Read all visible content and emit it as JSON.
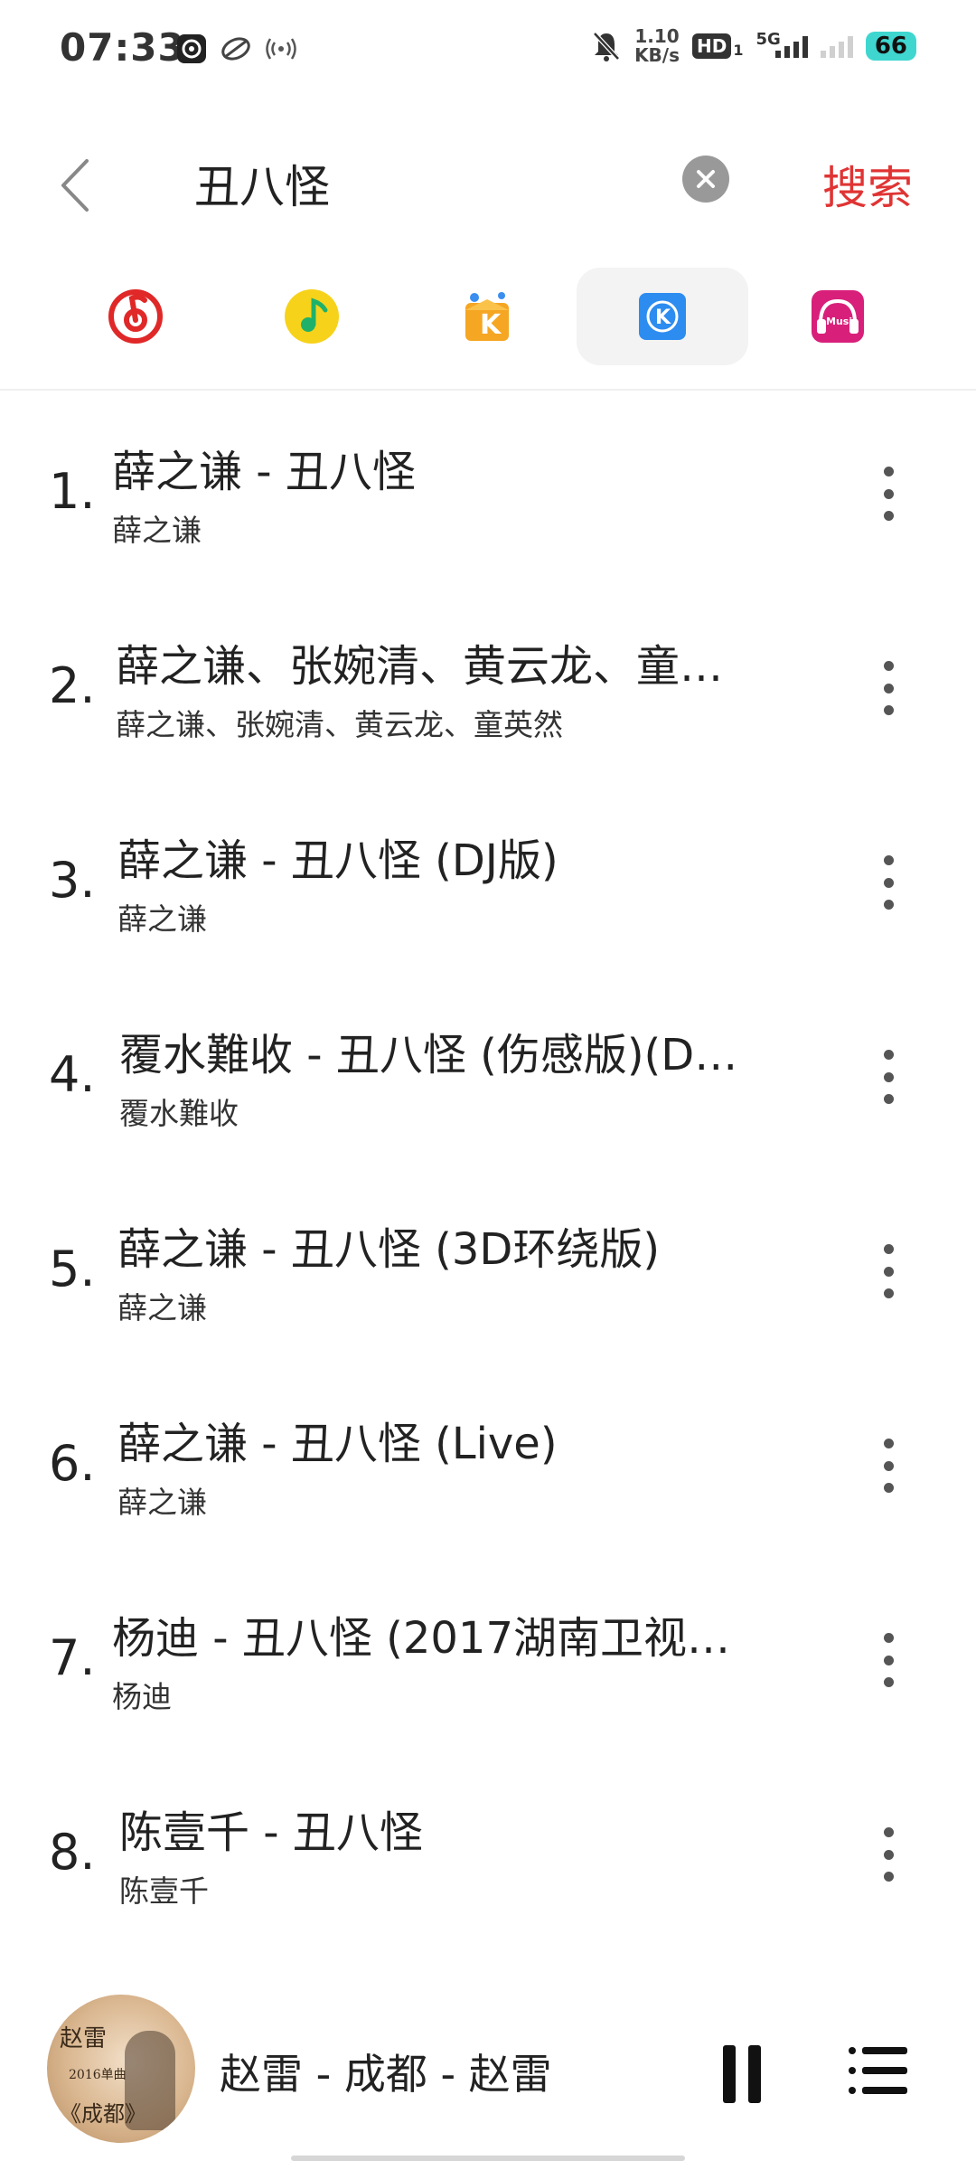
{
  "status_bar": {
    "time": "07:33",
    "netspeed_value": "1.10",
    "netspeed_unit": "KB/s",
    "hd": "HD",
    "hd_sub": "1",
    "network": "5G",
    "battery": "66"
  },
  "search": {
    "query": "丑八怪",
    "search_button": "搜索"
  },
  "source_tabs": [
    {
      "name": "netease-cloud-music",
      "active": false
    },
    {
      "name": "qq-music",
      "active": false
    },
    {
      "name": "kuwo-music",
      "active": false
    },
    {
      "name": "kugou-music",
      "active": true
    },
    {
      "name": "migu-music",
      "active": false
    }
  ],
  "songs": [
    {
      "index": "1.",
      "title": "薛之谦 - 丑八怪",
      "artist": "薛之谦"
    },
    {
      "index": "2.",
      "title": "薛之谦、张婉清、黄云龙、童…",
      "artist": "薛之谦、张婉清、黄云龙、童英然"
    },
    {
      "index": "3.",
      "title": "薛之谦 - 丑八怪 (DJ版)",
      "artist": "薛之谦"
    },
    {
      "index": "4.",
      "title": "覆水難收 - 丑八怪 (伤感版)(D…",
      "artist": "覆水難收"
    },
    {
      "index": "5.",
      "title": "薛之谦 - 丑八怪 (3D环绕版)",
      "artist": "薛之谦"
    },
    {
      "index": "6.",
      "title": "薛之谦 - 丑八怪 (Live)",
      "artist": "薛之谦"
    },
    {
      "index": "7.",
      "title": "杨迪 - 丑八怪 (2017湖南卫视…",
      "artist": "杨迪"
    },
    {
      "index": "8.",
      "title": "陈壹千 - 丑八怪",
      "artist": "陈壹千"
    }
  ],
  "now_playing": {
    "title": "赵雷 - 成都 - 赵雷",
    "album_text_a": "赵雷",
    "album_text_b": "2016单曲",
    "album_text_c": "《成都》"
  },
  "colors": {
    "accent": "#e03434",
    "kugou": "#2d8cf0",
    "netease": "#e02828",
    "qq": "#f7d21b",
    "migu": "#d8207a"
  }
}
